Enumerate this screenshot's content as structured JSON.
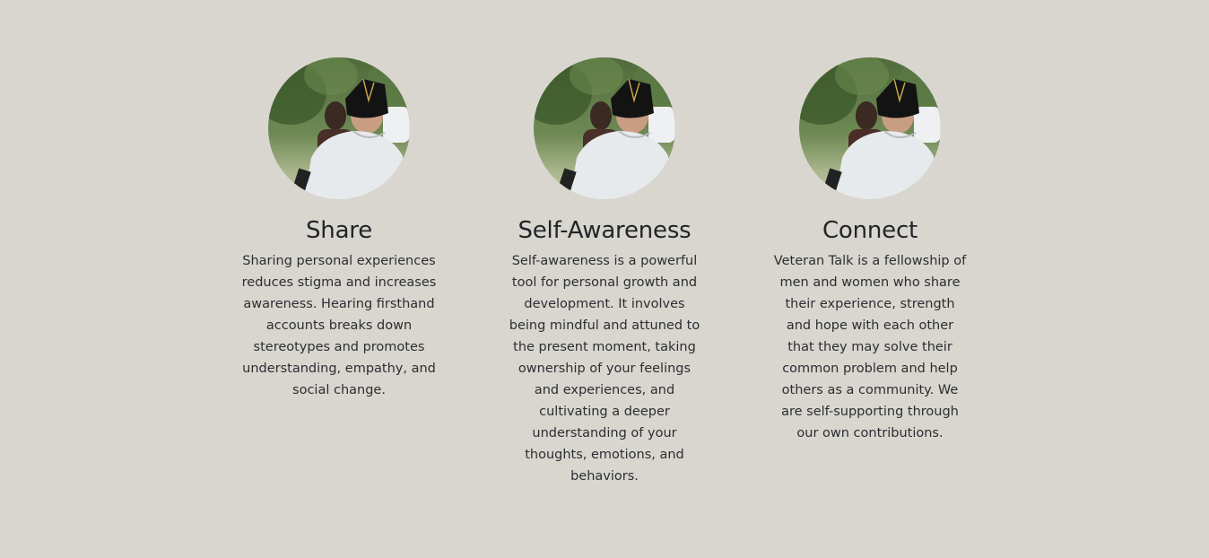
{
  "features": [
    {
      "icon": "veteran-photo",
      "title": "Share",
      "text": "Sharing personal experiences reduces stigma and increases awareness. Hearing firsthand accounts breaks down stereotypes and promotes understanding, empathy, and social change."
    },
    {
      "icon": "veteran-photo",
      "title": "Self-Awareness",
      "text": "Self-awareness is a powerful tool for personal growth and development. It involves being mindful and attuned to the present moment, taking ownership of your feelings and experiences, and cultivating a deeper understanding of your thoughts, emotions, and behaviors."
    },
    {
      "icon": "veteran-photo",
      "title": "Connect",
      "text": "Veteran Talk is a fellowship of men and women who share their experience, strength and hope with each other that they may solve their common problem and help others as a community. We are self-supporting through our own contributions."
    }
  ],
  "colors": {
    "background": "#d9d6d0",
    "heading": "#212529",
    "body_text": "#2b2e31"
  }
}
